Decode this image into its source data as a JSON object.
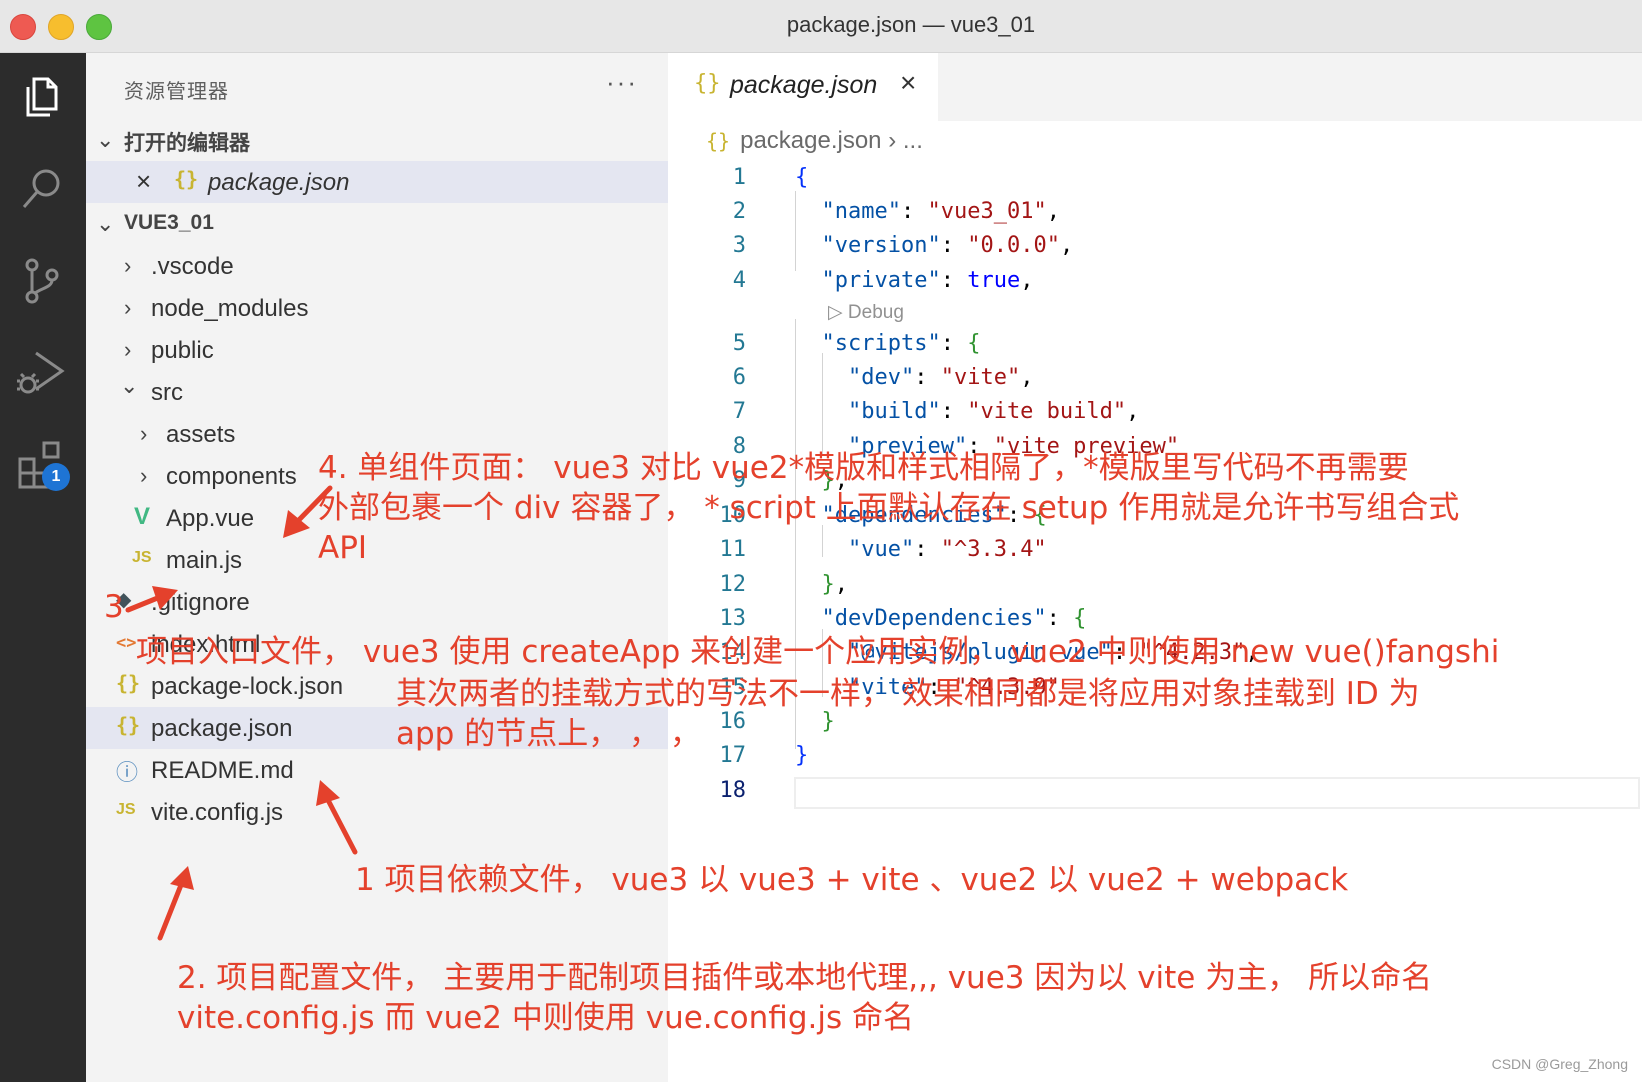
{
  "window": {
    "title": "package.json — vue3_01"
  },
  "activity_bar": {
    "icons": [
      "explorer-icon",
      "search-icon",
      "source-control-icon",
      "run-debug-icon",
      "extensions-icon"
    ],
    "extensions_badge": "1"
  },
  "sidebar": {
    "title": "资源管理器",
    "more": "···",
    "open_editors": {
      "header": "打开的编辑器",
      "items": [
        {
          "close": "×",
          "icon": "{}",
          "label": "package.json"
        }
      ]
    },
    "project": {
      "header": "VUE3_01",
      "tree": [
        {
          "label": ".vscode",
          "chevron": "›"
        },
        {
          "label": "node_modules",
          "chevron": "›"
        },
        {
          "label": "public",
          "chevron": "›"
        },
        {
          "label": "src",
          "chevron": "⌄"
        },
        {
          "label": "assets",
          "chevron": "›"
        },
        {
          "label": "components",
          "chevron": "›"
        },
        {
          "label": "App.vue",
          "icon": "V"
        },
        {
          "label": "main.js",
          "icon": "JS"
        },
        {
          "label": ".gitignore",
          "icon": "◆"
        },
        {
          "label": "index.html",
          "icon": "<>"
        },
        {
          "label": "package-lock.json",
          "icon": "{}"
        },
        {
          "label": "package.json",
          "icon": "{}"
        },
        {
          "label": "README.md",
          "icon": "ⓘ"
        },
        {
          "label": "vite.config.js",
          "icon": "JS"
        }
      ]
    }
  },
  "editor": {
    "tab": {
      "icon": "{}",
      "label": "package.json",
      "close": "×"
    },
    "breadcrumb": {
      "icon": "{}",
      "file": "package.json",
      "sep": "›",
      "rest": "..."
    },
    "line_numbers": [
      "1",
      "2",
      "3",
      "4",
      "5",
      "6",
      "7",
      "8",
      "9",
      "10",
      "11",
      "12",
      "13",
      "14",
      "15",
      "16",
      "17",
      "18"
    ],
    "codelens": "Debug",
    "code": {
      "l1": "{",
      "l2_key": "\"name\"",
      "l2_val": "\"vue3_01\"",
      "l3_key": "\"version\"",
      "l3_val": "\"0.0.0\"",
      "l4_key": "\"private\"",
      "l4_val": "true",
      "l5_key": "\"scripts\"",
      "l5_open": "{",
      "l6_key": "\"dev\"",
      "l6_val": "\"vite\"",
      "l7_key": "\"build\"",
      "l7_val": "\"vite build\"",
      "l8_key": "\"preview\"",
      "l8_val": "\"vite preview\"",
      "l9_close": "}",
      "l10_key": "\"dependencies\"",
      "l10_open": "{",
      "l11_key": "\"vue\"",
      "l11_val": "\"^3.3.4\"",
      "l12_close": "}",
      "l13_key": "\"devDependencies\"",
      "l13_open": "{",
      "l14_key": "\"@vitejs/plugin-vue\"",
      "l14_val": "\"^4.2.3\"",
      "l15_key": "\"vite\"",
      "l15_val": "\"^4.3.9\"",
      "l16_close": "}",
      "l17_close": "}"
    }
  },
  "annotations": {
    "a4_line1": "4. 单组件页面：  vue3 对比 vue2*模版和样式相隔了，*模版里写代码不再需要",
    "a4_line2": "外部包裹一个 div 容器了，  * script 上面默认存在 setup 作用就是允许书写组合式",
    "a4_line3": "API",
    "a3_num": "3",
    "a3_line1": "项目入口文件，  vue3 使用 createApp 来创建一个应用实例，  vue2 中则使用 new  vue()fangshi",
    "a3_line2": "其次两者的挂载方式的写法不一样，  效果相同都是将应用对象挂载到 ID 为",
    "a3_line3": "app 的节点上，  ，  ，",
    "a1": "1 项目依赖文件，  vue3 以 vue3 + vite  、vue2 以 vue2 + webpack",
    "a2_line1": "2. 项目配置文件，  主要用于配制项目插件或本地代理,,,  vue3 因为以 vite 为主，  所以命名",
    "a2_line2": "vite.config.js 而 vue2 中则使用 vue.config.js 命名"
  },
  "watermark": "CSDN @Greg_Zhong",
  "colors": {
    "annotation": "#e4412c",
    "activity_bar": "#2c2c2c",
    "badge": "#1e74d4"
  }
}
